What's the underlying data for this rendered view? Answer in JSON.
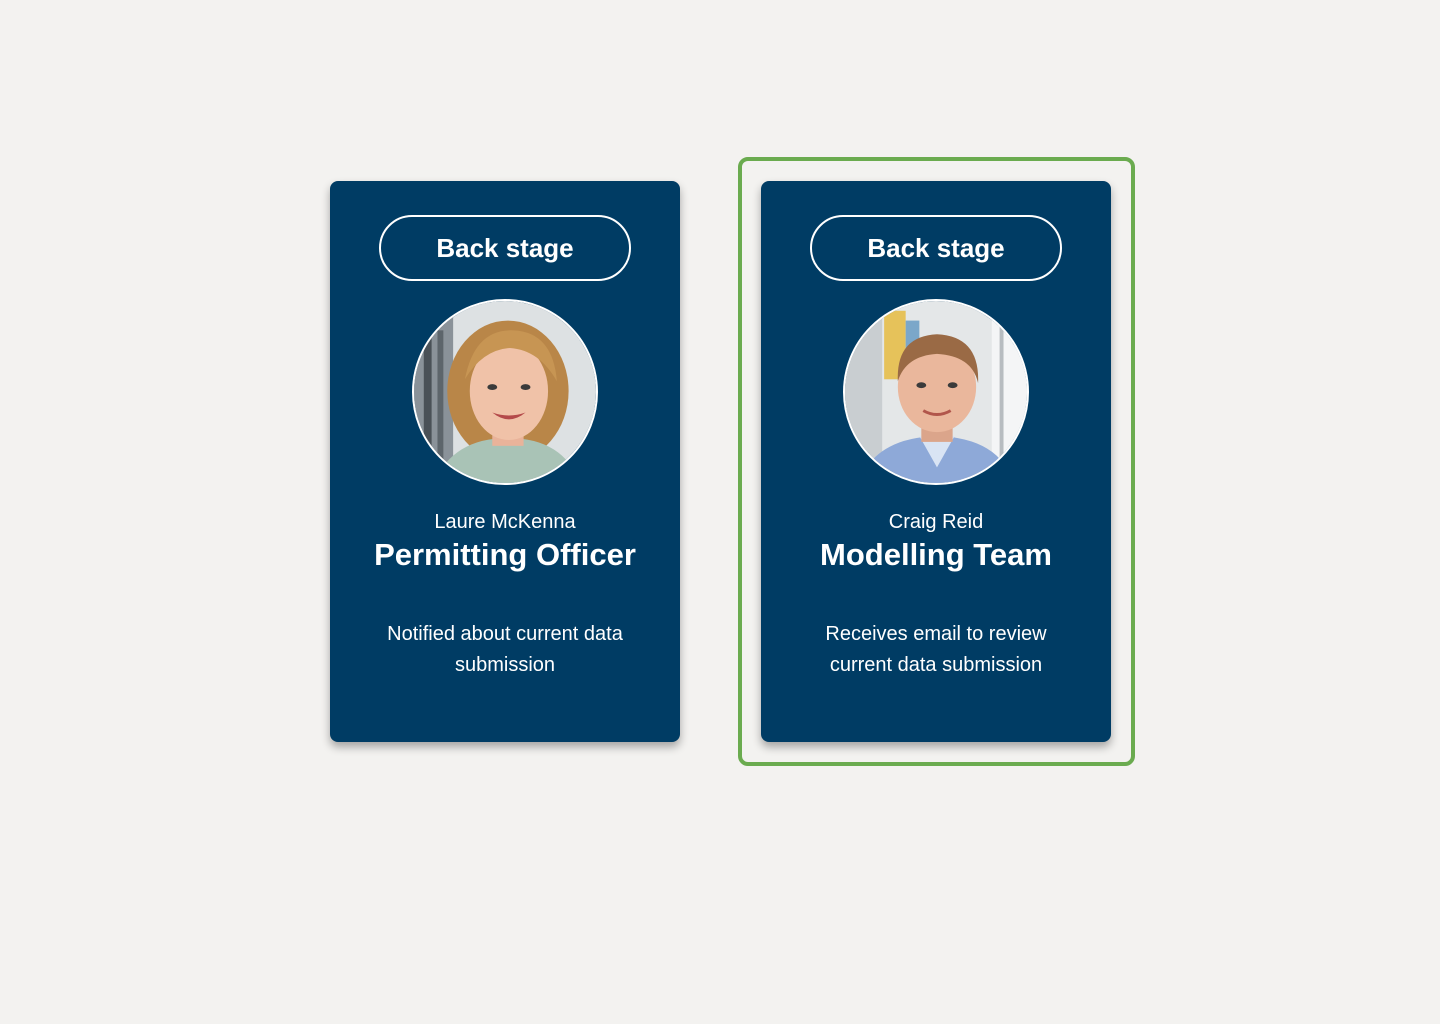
{
  "cards": [
    {
      "button_label": "Back stage",
      "avatar_icon": "woman-portrait-photo",
      "name": "Laure McKenna",
      "role": "Permitting Officer",
      "description": "Notified about current data submission"
    },
    {
      "button_label": "Back stage",
      "avatar_icon": "man-portrait-photo",
      "name": "Craig Reid",
      "role": "Modelling Team",
      "description": "Receives email to review current data submission"
    }
  ],
  "colors": {
    "background": "#f3f2f0",
    "card": "#003c64",
    "selection_outline": "#6aab4f",
    "text": "#ffffff"
  }
}
